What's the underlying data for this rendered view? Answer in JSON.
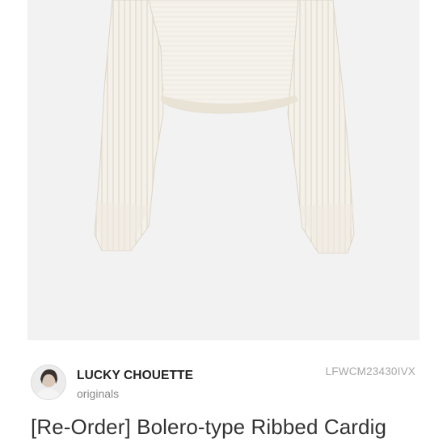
{
  "product": {
    "image_icon": "cardigan-product-photo"
  },
  "brand": {
    "avatar_icon": "brand-avatar-icon",
    "name": "LUCKY CHOUETTE",
    "subtitle": "originals",
    "product_code": "LFWCM23430IVX"
  },
  "title": "[Re-Order] Bolero-type Ribbed Cardig",
  "colors": {
    "image_background": "#f2f2f2",
    "garment": "#f4f1ea",
    "brand_text": "#222222",
    "muted_text": "#8a8a8a",
    "code_text": "#a6a6a6",
    "title_text": "#333333"
  }
}
